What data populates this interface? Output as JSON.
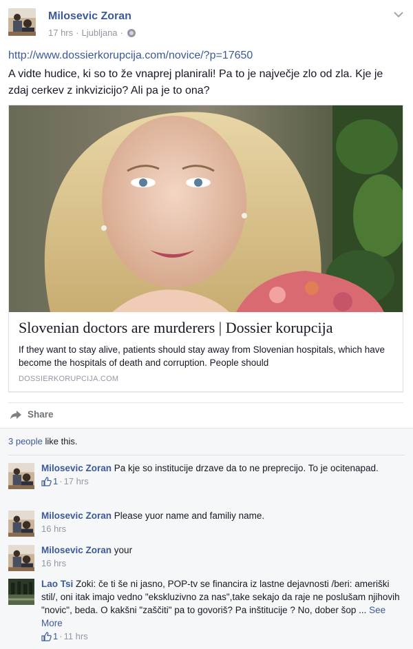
{
  "post": {
    "author": "Milosevic Zoran",
    "time": "17 hrs",
    "separator": "·",
    "location": "Ljubljana",
    "privacy_icon": "globe-icon",
    "link": "http://www.dossierkorupcija.com/novice/?p=17650",
    "text": "A vidte hudice, ki so to že vnaprej planirali! Pa to je največje zlo od zla. Kje je zdaj cerkev z inkvizicijo? Ali pa je to ona?"
  },
  "card": {
    "title": "Slovenian doctors are murderers | Dossier korupcija",
    "description": "If they want to stay alive, patients should stay away from Slovenian hospitals, which have become the hospitals of death and corruption. People should",
    "domain": "DOSSIERKORUPCIJA.COM"
  },
  "actions": {
    "share_label": "Share"
  },
  "likes": {
    "count_text": "3 people",
    "suffix": " like this."
  },
  "comments": [
    {
      "author": "Milosevic Zoran",
      "text": "Pa kje so institucije drzave da to ne preprecijo. To je ocitenapad.",
      "likes": "1",
      "separator": "·",
      "time": "17 hrs"
    },
    {
      "author": "Milosevic Zoran",
      "text": "Please yuor name and familiy name.",
      "time": "16 hrs"
    },
    {
      "author": "Milosevic Zoran",
      "text": "your",
      "time": "16 hrs"
    },
    {
      "author": "Lao Tsi",
      "text": "Zoki: če ti še ni jasno, POP-tv se financira iz lastne dejavnosti /beri: ameriški stil/, oni itak imajo vedno \"ekskluzivno za nas\",take sekajo da raje ne poslušam njihovih \"novic\", beda. O kakšni \"zaščiti\" pa to govoriš? Pa inštitucije ? No, dober šop ...",
      "see_more": "See More",
      "likes": "1",
      "separator": "·",
      "time": "11 hrs"
    }
  ],
  "colors": {
    "link_blue": "#3b5998",
    "meta_gray": "#9197a3",
    "comments_bg": "#f6f7f9"
  }
}
